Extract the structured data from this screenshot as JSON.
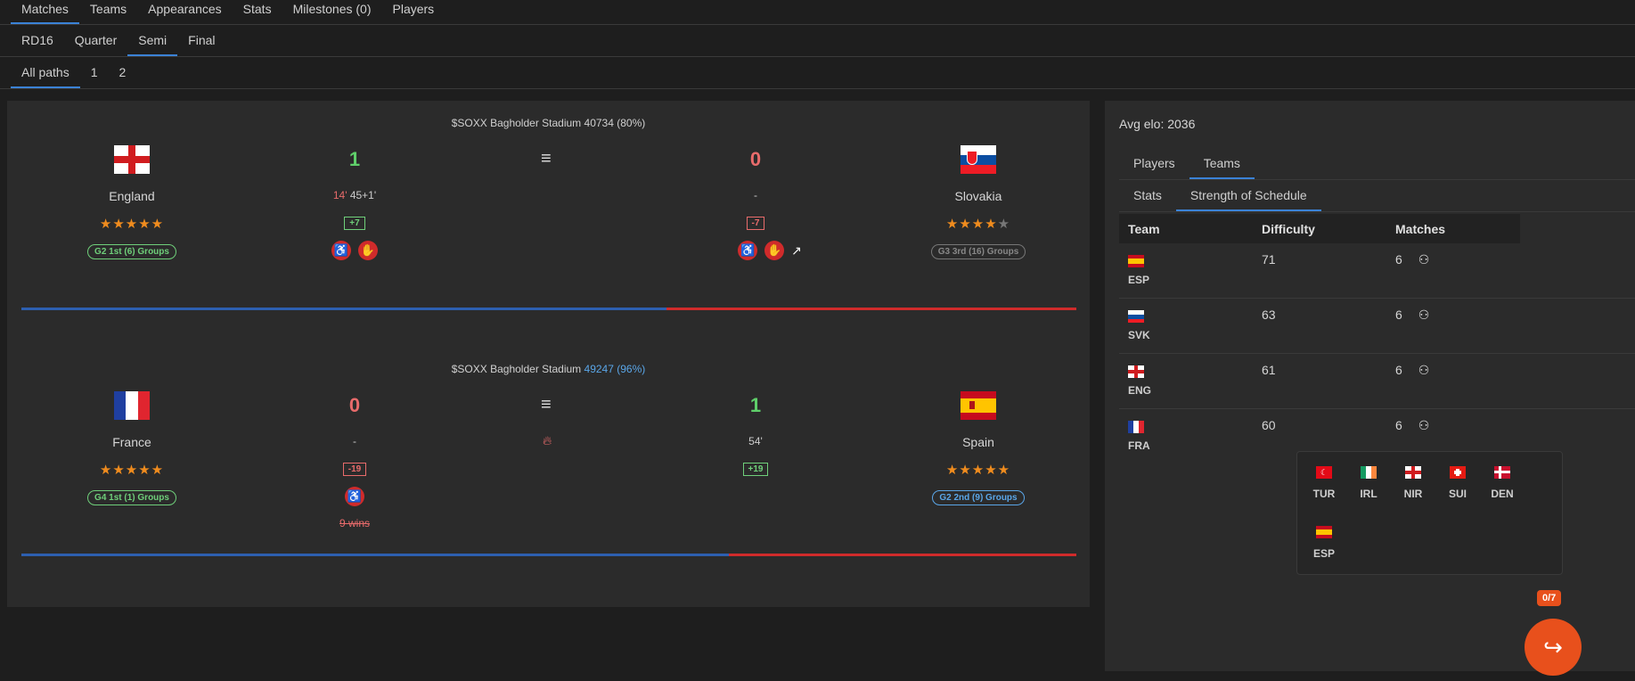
{
  "tabs": {
    "top": [
      "Matches",
      "Teams",
      "Appearances",
      "Stats",
      "Milestones (0)",
      "Players"
    ],
    "rounds": [
      "RD16",
      "Quarter",
      "Semi",
      "Final"
    ],
    "paths": [
      "All paths",
      "1",
      "2"
    ]
  },
  "matches": [
    {
      "stadium": "$SOXX Bagholder Stadium",
      "attendance": "40734 (80%)",
      "home": {
        "name": "England",
        "score": "1",
        "goals_red": "14'",
        "goals": " 45+1'",
        "diff": "+7",
        "stars": "★★★★★",
        "badge": "G2 1st (6) Groups"
      },
      "away": {
        "name": "Slovakia",
        "score": "0",
        "goals": "-",
        "diff": "-7",
        "stars_on": "★★★★",
        "stars_off": "★",
        "badge": "G3 3rd (16) Groups"
      }
    },
    {
      "stadium": "$SOXX Bagholder Stadium",
      "attendance": "49247 (96%)",
      "home": {
        "name": "France",
        "score": "0",
        "goals": "-",
        "diff": "-19",
        "stars": "★★★★★",
        "badge": "G4 1st (1) Groups",
        "wins": "9 wins"
      },
      "away": {
        "name": "Spain",
        "score": "1",
        "goals": "54'",
        "diff": "+19",
        "stars": "★★★★★",
        "badge": "G2 2nd (9) Groups"
      }
    }
  ],
  "side": {
    "avg_elo": "Avg elo: 2036",
    "tabs1": [
      "Players",
      "Teams"
    ],
    "tabs2": [
      "Stats",
      "Strength of Schedule"
    ],
    "headers": [
      "Team",
      "Difficulty",
      "Matches"
    ],
    "rows": [
      {
        "code": "ESP",
        "difficulty": "71",
        "matches": "6"
      },
      {
        "code": "SVK",
        "difficulty": "63",
        "matches": "6"
      },
      {
        "code": "ENG",
        "difficulty": "61",
        "matches": "6"
      },
      {
        "code": "FRA",
        "difficulty": "60",
        "matches": "6"
      }
    ],
    "popup": [
      "TUR",
      "IRL",
      "NIR",
      "SUI",
      "DEN",
      "ESP"
    ]
  },
  "counter": "0/7",
  "icons": {
    "menu": "menu-icon",
    "wheelchair": "wheelchair-icon",
    "glove": "glove-icon",
    "trend": "trending-up-icon",
    "flame": "flame-icon",
    "group": "group-icon",
    "share": "share-icon"
  }
}
